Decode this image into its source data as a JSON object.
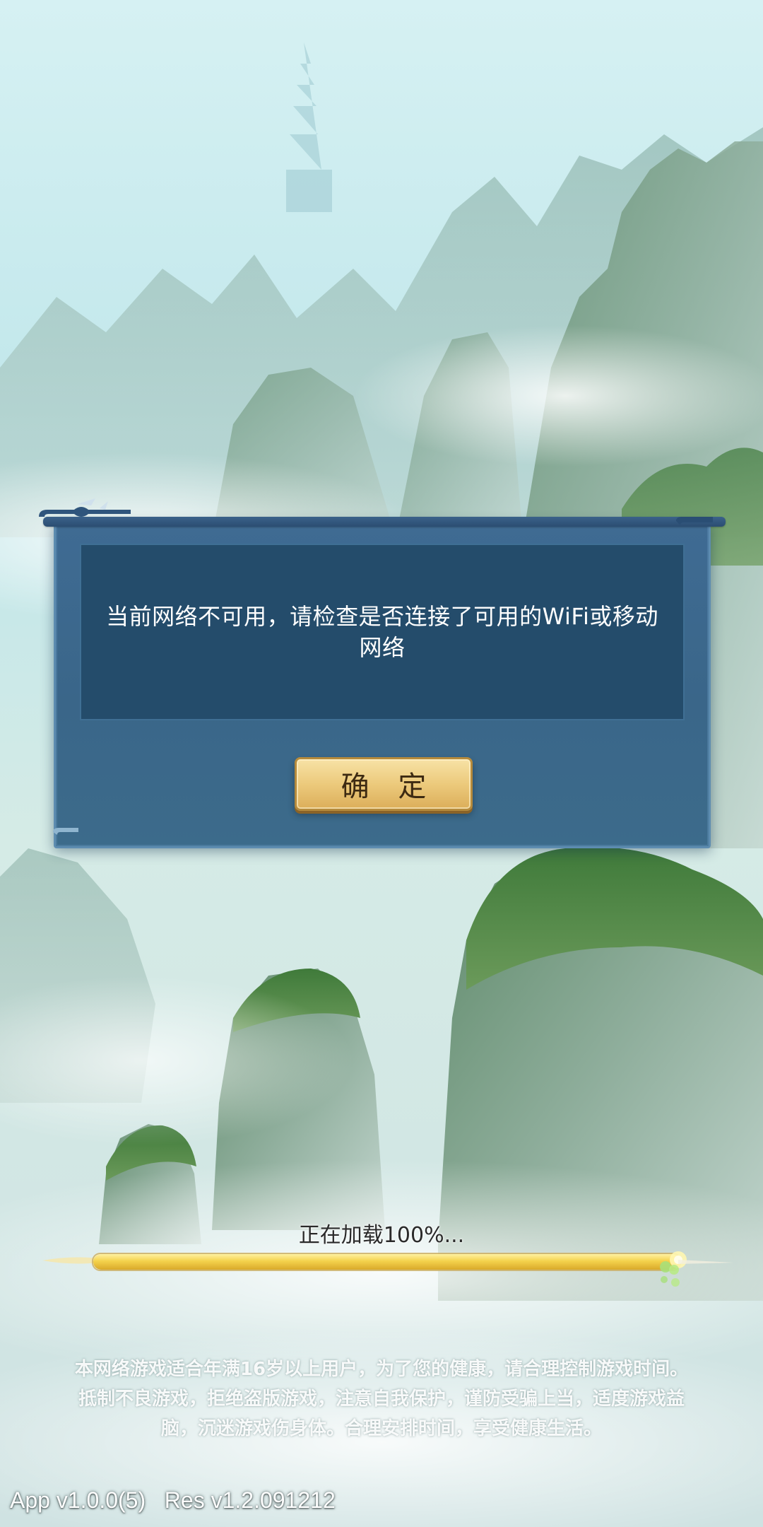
{
  "colors": {
    "dialog_bg": "#3a6689",
    "message_bg": "#244c6b",
    "button_gold": "#ecca7c",
    "progress_gold": "#f4d24c"
  },
  "dialog": {
    "message": "当前网络不可用，请检查是否连接了可用的WiFi或移动网络",
    "confirm_label": "确 定"
  },
  "loading": {
    "text": "正在加载100%...",
    "progress": 1.0
  },
  "notice": {
    "line1": "本网络游戏适合年满16岁以上用户，为了您的健康，请合理控制游戏时间。",
    "line2": "抵制不良游戏，拒绝盗版游戏，注意自我保护，谨防受骗上当，适度游戏益",
    "line3": "脑，沉迷游戏伤身体。合理安排时间，享受健康生活。"
  },
  "version": "App v1.0.0(5)   Res v1.2.091212"
}
